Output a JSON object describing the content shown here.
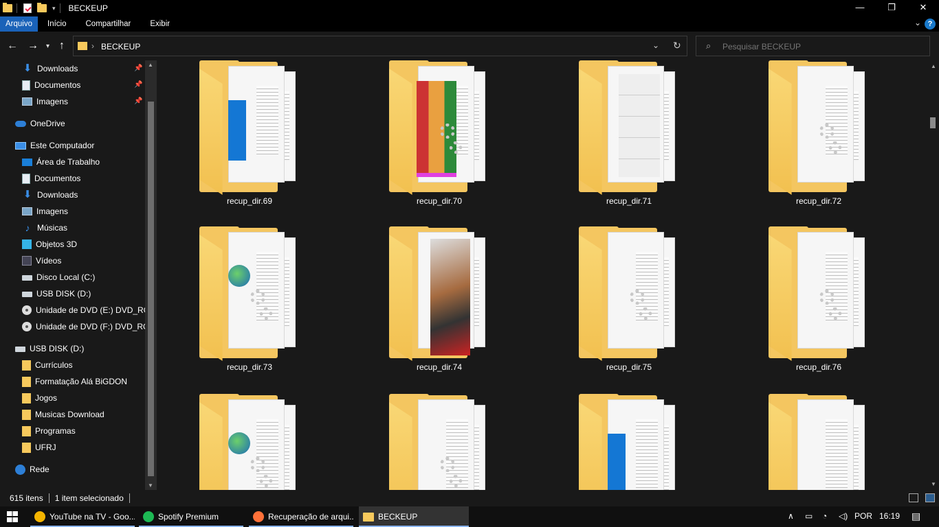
{
  "window": {
    "title": "BECKEUP",
    "controls": {
      "minimize": "—",
      "maximize": "❐",
      "close": "✕"
    }
  },
  "ribbon": {
    "tabs": [
      "Arquivo",
      "Início",
      "Compartilhar",
      "Exibir"
    ],
    "active_tab": "Arquivo",
    "help_label": "?"
  },
  "address": {
    "path": "BECKEUP",
    "separator": "›"
  },
  "search": {
    "placeholder": "Pesquisar BECKEUP"
  },
  "sidebar": {
    "items": [
      {
        "label": "Downloads",
        "icon": "download-icon",
        "pinned": true
      },
      {
        "label": "Documentos",
        "icon": "document-icon",
        "pinned": true
      },
      {
        "label": "Imagens",
        "icon": "pictures-icon",
        "pinned": true
      },
      {
        "label": "OneDrive",
        "icon": "onedrive-icon"
      },
      {
        "label": "Este Computador",
        "icon": "computer-icon"
      },
      {
        "label": "Área de Trabalho",
        "icon": "desktop-icon"
      },
      {
        "label": "Documentos",
        "icon": "document-icon"
      },
      {
        "label": "Downloads",
        "icon": "download-icon"
      },
      {
        "label": "Imagens",
        "icon": "pictures-icon"
      },
      {
        "label": "Músicas",
        "icon": "music-icon"
      },
      {
        "label": "Objetos 3D",
        "icon": "objects-3d-icon"
      },
      {
        "label": "Vídeos",
        "icon": "videos-icon"
      },
      {
        "label": "Disco Local (C:)",
        "icon": "drive-icon"
      },
      {
        "label": "USB DISK (D:)",
        "icon": "usb-drive-icon"
      },
      {
        "label": "Unidade de DVD (E:) DVD_ROM",
        "icon": "dvd-icon"
      },
      {
        "label": "Unidade de DVD (F:) DVD_ROM",
        "icon": "dvd-icon"
      },
      {
        "label": "USB DISK (D:)",
        "icon": "usb-drive-icon"
      },
      {
        "label": "Currículos",
        "icon": "folder-icon"
      },
      {
        "label": "Formatação Alá BiGDON",
        "icon": "folder-icon"
      },
      {
        "label": "Jogos",
        "icon": "folder-icon"
      },
      {
        "label": "Musicas Download",
        "icon": "folder-icon"
      },
      {
        "label": "Programas",
        "icon": "folder-icon"
      },
      {
        "label": "UFRJ",
        "icon": "folder-icon"
      },
      {
        "label": "Rede",
        "icon": "network-icon"
      }
    ]
  },
  "files": [
    {
      "name": "recup_dir.69",
      "thumb": "blue"
    },
    {
      "name": "recup_dir.70",
      "thumb": "rar"
    },
    {
      "name": "recup_dir.71",
      "thumb": "table"
    },
    {
      "name": "recup_dir.72",
      "thumb": "gear"
    },
    {
      "name": "recup_dir.73",
      "thumb": "globe"
    },
    {
      "name": "recup_dir.74",
      "thumb": "photo"
    },
    {
      "name": "recup_dir.75",
      "thumb": "gear"
    },
    {
      "name": "recup_dir.76",
      "thumb": "gear"
    },
    {
      "name": "",
      "thumb": "globe"
    },
    {
      "name": "",
      "thumb": "gear"
    },
    {
      "name": "",
      "thumb": "blue"
    },
    {
      "name": "",
      "thumb": "doc"
    }
  ],
  "status": {
    "item_count": "615 itens",
    "selection": "1 item selecionado"
  },
  "taskbar": {
    "apps": [
      {
        "label": "YouTube na TV - Goo...",
        "icon": "chrome-icon",
        "color": "#f4b400"
      },
      {
        "label": "Spotify Premium",
        "icon": "spotify-icon",
        "color": "#1db954"
      },
      {
        "label": "Recuperação de arqui...",
        "icon": "firefox-icon",
        "color": "#ff7139"
      },
      {
        "label": "BECKEUP",
        "icon": "folder-icon",
        "color": "#f7c95c"
      }
    ],
    "language": "POR",
    "time": "16:19"
  },
  "colors": {
    "accent": "#1a62b8",
    "background": "#191919",
    "folder": "#f4c660"
  }
}
